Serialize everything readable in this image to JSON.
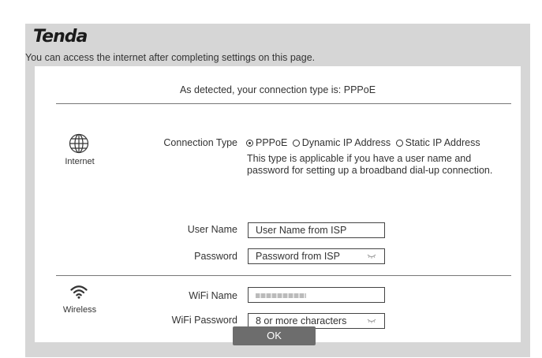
{
  "brand": {
    "logo_text": "Tenda"
  },
  "header": {
    "subtitle": "You can access the internet after completing settings on this page."
  },
  "detect_text": "As detected, your connection type is: PPPoE",
  "internet": {
    "icon_label": "Internet",
    "connection_type_label": "Connection Type",
    "options": [
      "PPPoE",
      "Dynamic IP Address",
      "Static IP Address"
    ],
    "selected": "PPPoE",
    "description": "This type is applicable if you have a user name and password for setting up a broadband dial-up connection.",
    "username_label": "User Name",
    "username_placeholder": "User Name from ISP",
    "password_label": "Password",
    "password_placeholder": "Password from ISP"
  },
  "wireless": {
    "icon_label": "Wireless",
    "wifi_name_label": "WiFi Name",
    "wifi_password_label": "WiFi Password",
    "wifi_password_placeholder": "8 or more characters"
  },
  "ok_label": "OK"
}
